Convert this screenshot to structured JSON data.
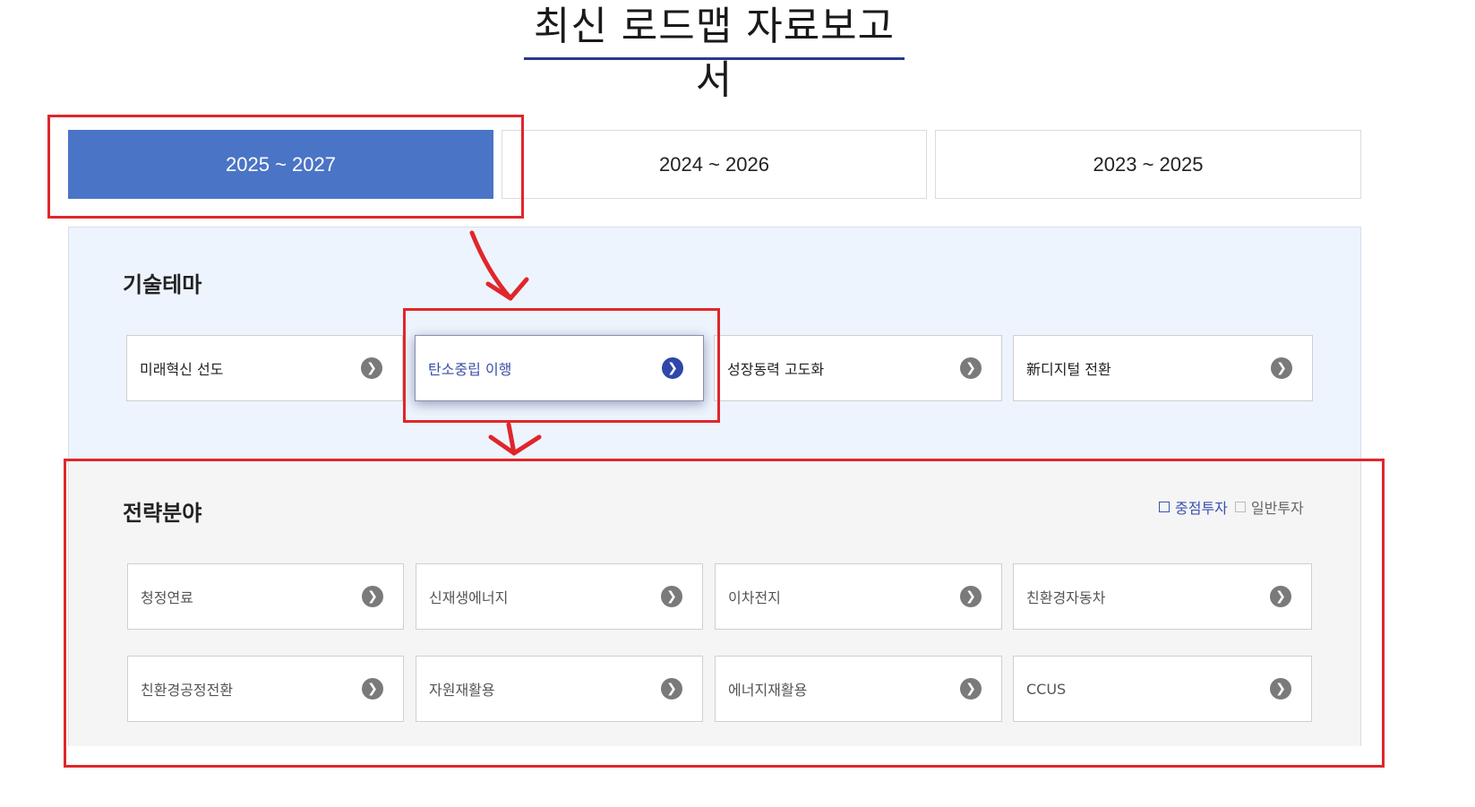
{
  "page": {
    "title": "최신 로드맵 자료보고서"
  },
  "tabs": [
    {
      "label": "2025 ~ 2027",
      "active": true
    },
    {
      "label": "2024 ~ 2026",
      "active": false
    },
    {
      "label": "2023 ~ 2025",
      "active": false
    }
  ],
  "themes": {
    "title": "기술테마",
    "items": [
      {
        "label": "미래혁신 선도",
        "selected": false
      },
      {
        "label": "탄소중립 이행",
        "selected": true
      },
      {
        "label": "성장동력 고도화",
        "selected": false
      },
      {
        "label": "新디지털 전환",
        "selected": false
      }
    ]
  },
  "strategy": {
    "title": "전략분야",
    "legend": {
      "focus": "중점투자",
      "general": "일반투자"
    },
    "items": [
      {
        "label": "청정연료"
      },
      {
        "label": "신재생에너지"
      },
      {
        "label": "이차전지"
      },
      {
        "label": "친환경자동차"
      },
      {
        "label": "친환경공정전환"
      },
      {
        "label": "자원재활용"
      },
      {
        "label": "에너지재활용"
      },
      {
        "label": "CCUS"
      }
    ]
  },
  "colors": {
    "accent": "#4a74c6",
    "selected_text": "#3a4ea6",
    "annotation": "#e0262b"
  }
}
